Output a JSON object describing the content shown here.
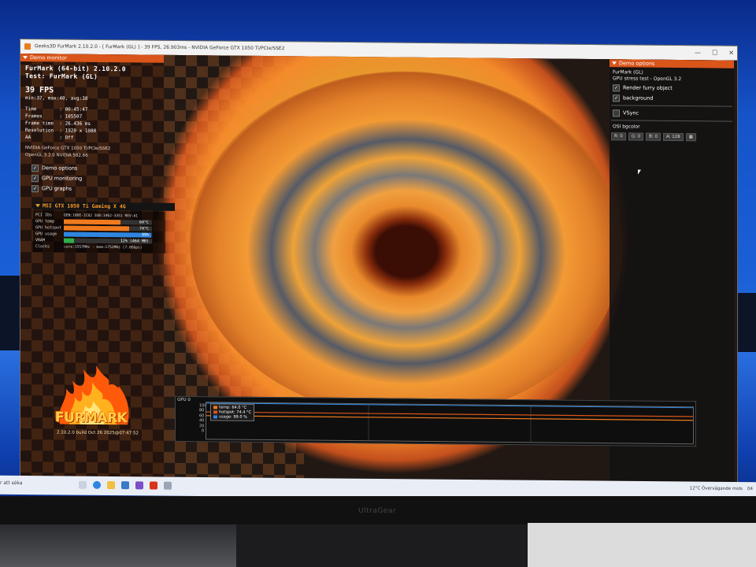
{
  "window": {
    "title": "Geeks3D FurMark 2.10.2.0 - [ FurMark (GL) ] - 39 FPS, 26.903ms - NVIDIA GeForce GTX 1050 Ti/PCIe/SSE2",
    "min": "—",
    "max": "☐",
    "close": "✕"
  },
  "demo_monitor": {
    "header": "Demo monitor",
    "app": "FurMark (64-bit) 2.10.2.0",
    "test": "Test: FurMark (GL)",
    "fps": "39 FPS",
    "fps_stats": "min:37, max:40, avg:38",
    "time": "Time        : 00:45:47",
    "frames": "Frames      : 105507",
    "frame_time": "Frame time  : 26.436 ms",
    "resolution": "Resolution  : 1920 x 1080",
    "aa": "AA          : Off",
    "gpu_name": "NVIDIA GeForce GTX 1050 Ti/PCIe/SSE2",
    "opengl": "OpenGL 3.2.0 NVIDIA 582.66",
    "checks": [
      {
        "label": "Demo options",
        "checked": "✓"
      },
      {
        "label": "GPU monitoring",
        "checked": "✓"
      },
      {
        "label": "GPU graphs",
        "checked": "✓"
      }
    ]
  },
  "gpu_monitor": {
    "header": "MSI GTX 1050 Ti Gaming X 4G",
    "pci_label": "PCI IDs",
    "pci_value": "GEN:10DE-1C82 SUB:1462-3351 REV:A1",
    "rows": [
      {
        "label": "GPU temp",
        "text": "64°C",
        "fill": 0.64,
        "color": "#f07a1e"
      },
      {
        "label": "GPU hotspot",
        "text": "74°C",
        "fill": 0.74,
        "color": "#f07a1e"
      },
      {
        "label": "GPU usage",
        "text": "99%",
        "fill": 0.99,
        "color": "#2f86e0"
      },
      {
        "label": "VRAM",
        "text": "12% (464 MB)",
        "fill": 0.12,
        "color": "#2fb04a"
      }
    ],
    "clocks_label": "Clocks",
    "clocks_value": "core:1557MHz - mem:1752MHz (7.0Gbps)"
  },
  "logo": {
    "text": "FURMARK",
    "build": "2.10.2.0 build Oct 26 2025@07:47:52"
  },
  "demo_options": {
    "header": "Demo options",
    "name": "FurMark (GL)",
    "desc": "GPU stress test - OpenGL 3.2",
    "checks": [
      {
        "label": "Render furry object",
        "checked": "✓"
      },
      {
        "label": "background",
        "checked": "✓"
      }
    ],
    "vsync": {
      "label": "VSync",
      "checked": ""
    },
    "osi_label": "OSI bgcolor",
    "bgcolor": [
      "R: 0",
      "G: 0",
      "B: 0",
      "A: 128"
    ]
  },
  "graph": {
    "label": "GPU 0",
    "y_ticks": [
      "100",
      "80",
      "60",
      "40",
      "20",
      "0"
    ],
    "legend": [
      {
        "label": "temp: 64.0 °C",
        "color": "#f07a1e",
        "value": 64.0
      },
      {
        "label": "hotspot: 74.4 °C",
        "color": "#d9551a",
        "value": 74.4
      },
      {
        "label": "usage: 99.0 %",
        "color": "#2f86e0",
        "value": 99.0
      }
    ]
  },
  "taskbar": {
    "search": "r att söka",
    "weather": "12°C  Övervägande mols",
    "time": "04"
  },
  "monitor_brand": "UltraGear"
}
